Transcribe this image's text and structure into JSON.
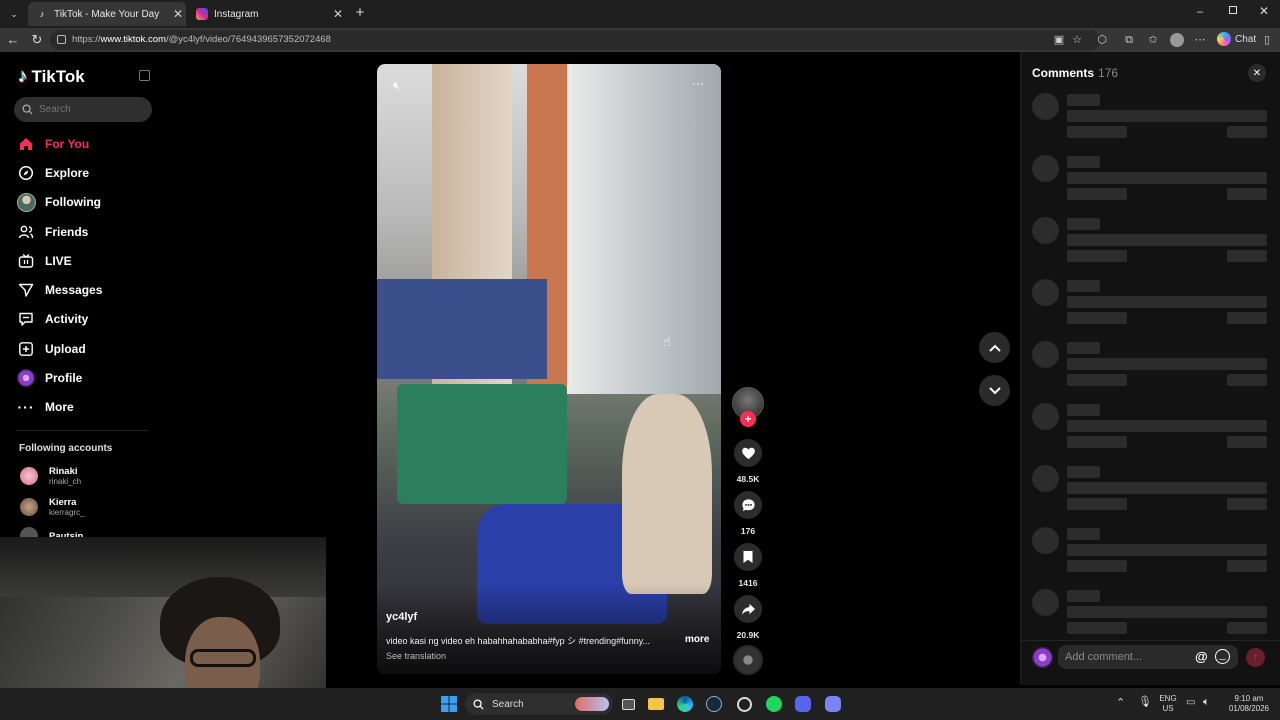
{
  "browser": {
    "tabs": [
      {
        "title": "TikTok - Make Your Day",
        "active": true
      },
      {
        "title": "Instagram",
        "active": false
      }
    ],
    "url_prefix": "https://",
    "url_domain": "www.tiktok.com",
    "url_path": "/@yc4lyf/video/7649439657352072468",
    "chat_label": "Chat"
  },
  "sidebar": {
    "logo": "TikTok",
    "search_placeholder": "Search",
    "nav": [
      {
        "label": "For You",
        "icon": "home-icon",
        "active": true
      },
      {
        "label": "Explore",
        "icon": "compass-icon"
      },
      {
        "label": "Following",
        "icon": "following-avatar-icon"
      },
      {
        "label": "Friends",
        "icon": "friends-icon"
      },
      {
        "label": "LIVE",
        "icon": "live-tv-icon"
      },
      {
        "label": "Messages",
        "icon": "send-icon"
      },
      {
        "label": "Activity",
        "icon": "activity-icon"
      },
      {
        "label": "Upload",
        "icon": "upload-plus-icon"
      },
      {
        "label": "Profile",
        "icon": "profile-avatar-icon"
      },
      {
        "label": "More",
        "icon": "more-dots-icon"
      }
    ],
    "following_title": "Following accounts",
    "accounts": [
      {
        "name": "Rinaki",
        "handle": "rinaki_ch"
      },
      {
        "name": "Kierra",
        "handle": "kierragrc_"
      },
      {
        "name": "Pautsin",
        "handle": ""
      }
    ]
  },
  "video": {
    "username": "yc4lyf",
    "caption": "video kasi ng video eh habahhahababha#fyp シ #trending#funny...",
    "more": "more",
    "see_translation": "See translation"
  },
  "actions": {
    "likes": "48.5K",
    "comments": "176",
    "saves": "1416",
    "shares": "20.9K"
  },
  "comments_panel": {
    "title": "Comments",
    "count": "176",
    "placeholder": "Add comment..."
  },
  "taskbar": {
    "search_label": "Search",
    "lang_top": "ENG",
    "lang_bottom": "US",
    "time": "9:10 am",
    "date": "01/08/2026"
  },
  "colors": {
    "accent": "#fe2c55",
    "bg": "#000000",
    "panel": "#121212",
    "skeleton": "#2c2c2c"
  }
}
